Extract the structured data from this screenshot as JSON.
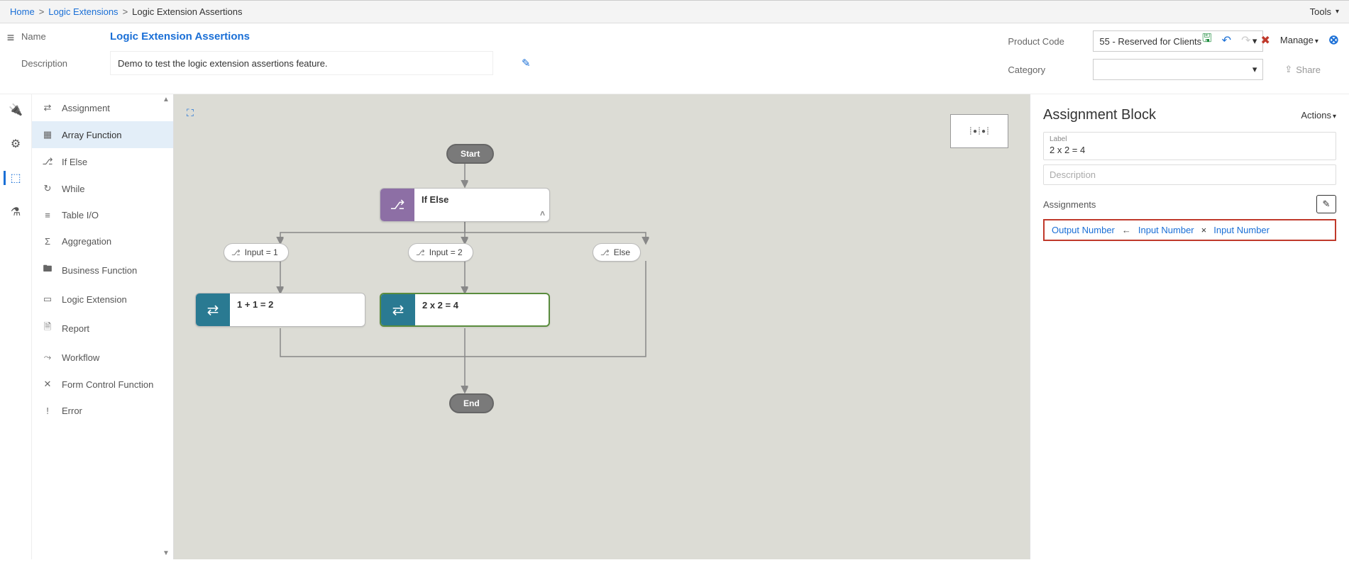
{
  "breadcrumb": {
    "home": "Home",
    "logic_extensions": "Logic Extensions",
    "current": "Logic Extension Assertions"
  },
  "tools_label": "Tools",
  "header": {
    "name_label": "Name",
    "name_value": "Logic Extension Assertions",
    "description_label": "Description",
    "description_value": "Demo to test the logic extension assertions feature.",
    "product_code_label": "Product Code",
    "product_code_value": "55 - Reserved for Clients",
    "category_label": "Category",
    "category_value": "",
    "share_label": "Share",
    "manage_label": "Manage"
  },
  "palette": [
    {
      "icon": "⇄",
      "label": "Assignment"
    },
    {
      "icon": "▦",
      "label": "Array Function"
    },
    {
      "icon": "⎇",
      "label": "If Else"
    },
    {
      "icon": "↻",
      "label": "While"
    },
    {
      "icon": "≡",
      "label": "Table I/O"
    },
    {
      "icon": "Σ",
      "label": "Aggregation"
    },
    {
      "icon": "🖿",
      "label": "Business Function"
    },
    {
      "icon": "▭",
      "label": "Logic Extension"
    },
    {
      "icon": "🗎",
      "label": "Report"
    },
    {
      "icon": "⤳",
      "label": "Workflow"
    },
    {
      "icon": "✕",
      "label": "Form Control Function"
    },
    {
      "icon": "!",
      "label": "Error"
    }
  ],
  "flow": {
    "start": "Start",
    "end": "End",
    "ifelse_label": "If Else",
    "branches": [
      {
        "label": "Input = 1"
      },
      {
        "label": "Input = 2"
      },
      {
        "label": "Else"
      }
    ],
    "assignments": [
      {
        "label": "1 + 1 = 2"
      },
      {
        "label": "2 x 2 = 4"
      }
    ]
  },
  "inspector": {
    "title": "Assignment Block",
    "actions_label": "Actions",
    "label_field_label": "Label",
    "label_field_value": "2 x 2 = 4",
    "description_placeholder": "Description",
    "assignments_heading": "Assignments",
    "assignment": {
      "output": "Output Number",
      "input1": "Input Number",
      "op": "×",
      "input2": "Input Number"
    }
  }
}
